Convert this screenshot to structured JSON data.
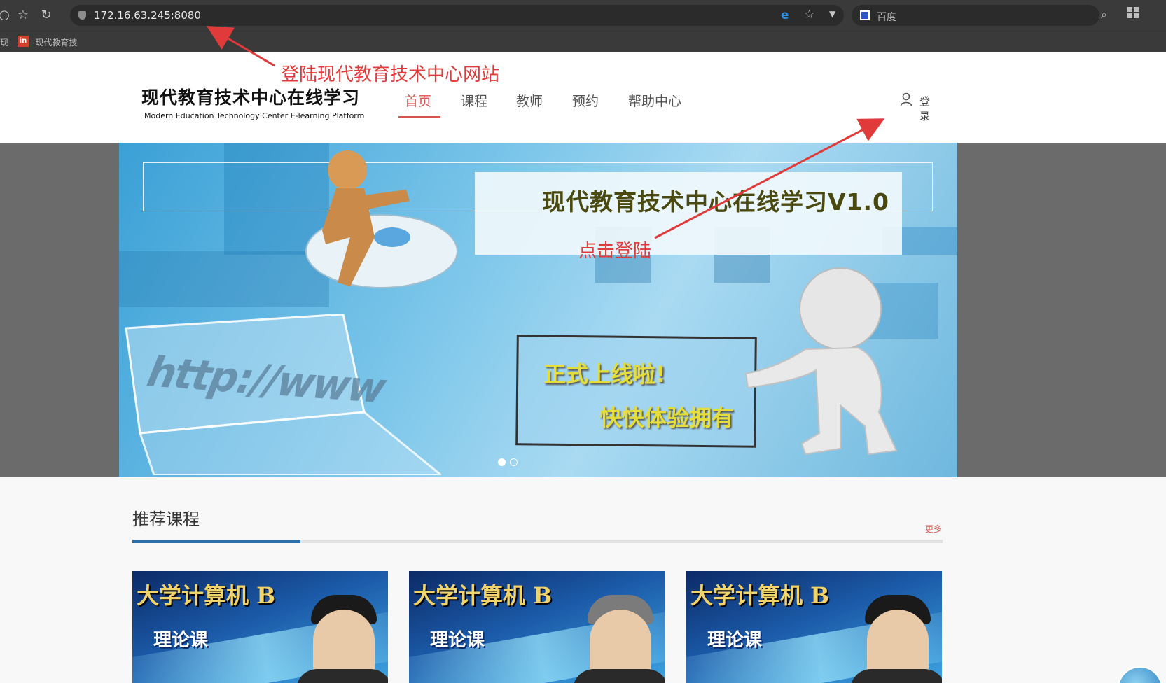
{
  "browser": {
    "address": "172.16.63.245:8080",
    "search_placeholder": "百度",
    "bookmarks": [
      "现",
      "-现代教育技"
    ],
    "bookmark_icon_text": "in"
  },
  "site": {
    "title": "现代教育技术中心在线学习",
    "subtitle": "Modern Education Technology Center E-learning Platform",
    "nav": [
      "首页",
      "课程",
      "教师",
      "预约",
      "帮助中心"
    ],
    "active_nav": "首页",
    "login_label": "登录"
  },
  "banner": {
    "title": "现代教育技术中心在线学习V1.0",
    "http_text": "http://www",
    "line1": "正式上线啦!",
    "line2": "快快体验拥有",
    "slide_count": 2,
    "active_slide": 1
  },
  "annotations": {
    "visit_site": "登陆现代教育技术中心网站",
    "click_login": "点击登陆"
  },
  "courses": {
    "heading": "推荐课程",
    "more_label": "更多",
    "cards": [
      {
        "title": "大学计算机 B",
        "tag": "理论课"
      },
      {
        "title": "大学计算机 B",
        "tag": "理论课"
      },
      {
        "title": "大学计算机 B",
        "tag": "理论课"
      }
    ]
  },
  "colors": {
    "accent": "#d9534f",
    "section_accent": "#2f6fa5",
    "annotation": "#e03a3a"
  }
}
